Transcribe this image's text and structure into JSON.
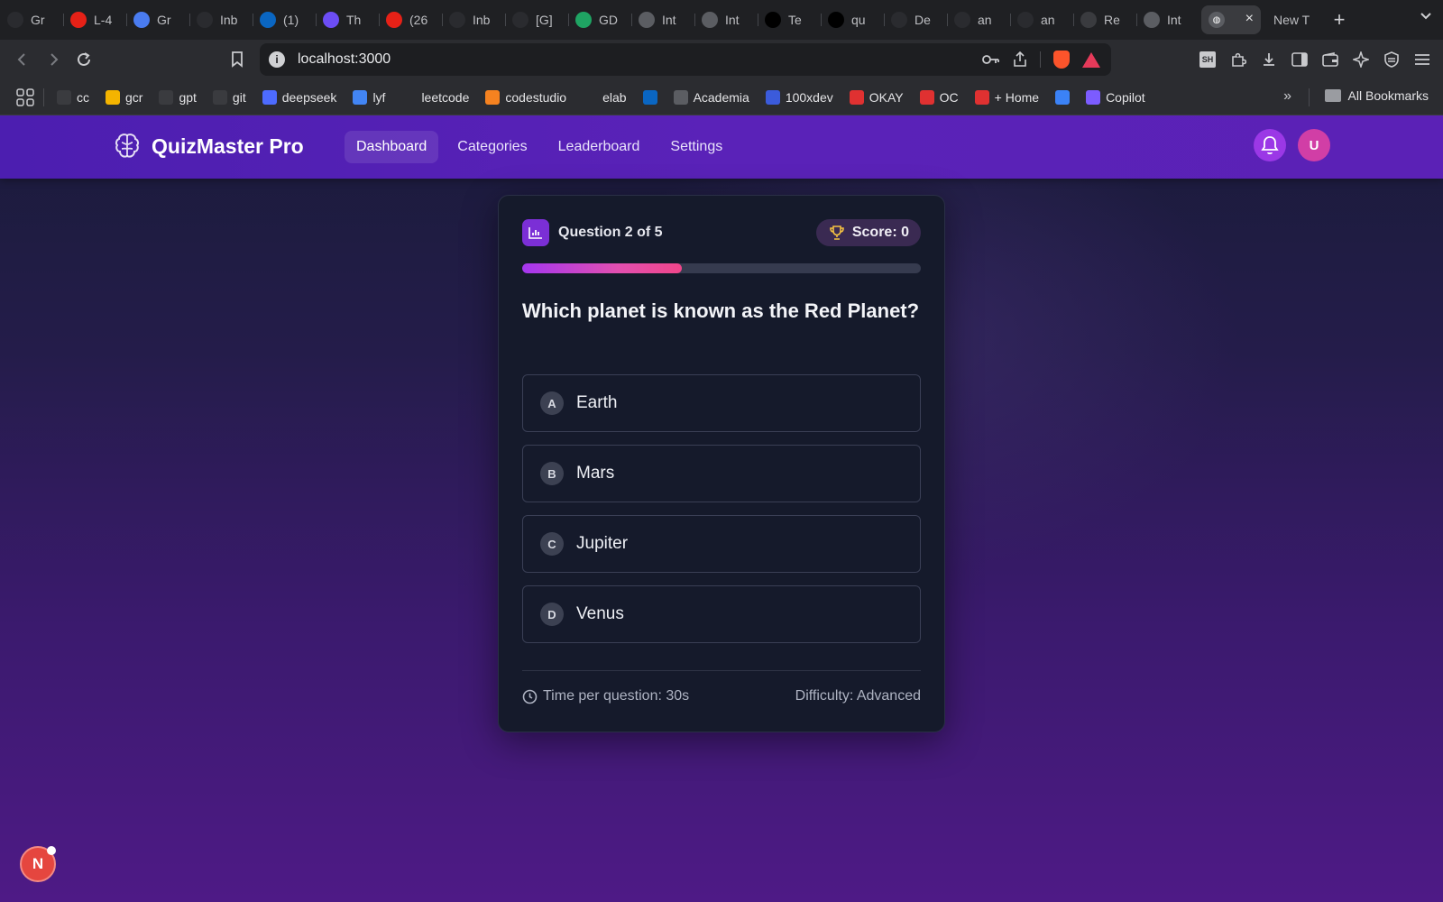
{
  "browser": {
    "tabs": [
      {
        "title": "Gr",
        "icon": "openai-icon",
        "color": "#2a2b2f"
      },
      {
        "title": "L-4",
        "icon": "youtube-icon",
        "color": "#e62117"
      },
      {
        "title": "Gr",
        "icon": "app-icon",
        "color": "#4a7cf0"
      },
      {
        "title": "Inb",
        "icon": "gmail-icon",
        "color": "#2a2b2f"
      },
      {
        "title": "(1)",
        "icon": "linkedin-icon",
        "color": "#0a66c2"
      },
      {
        "title": "Th",
        "icon": "app-icon",
        "color": "#6c4df5"
      },
      {
        "title": "(26",
        "icon": "youtube-icon",
        "color": "#e62117"
      },
      {
        "title": "Inb",
        "icon": "gmail-icon",
        "color": "#2a2b2f"
      },
      {
        "title": "[G]",
        "icon": "gmail-icon",
        "color": "#2a2b2f"
      },
      {
        "title": "GD",
        "icon": "drive-icon",
        "color": "#1fa463"
      },
      {
        "title": "Int",
        "icon": "globe-icon",
        "color": "#5b5d62"
      },
      {
        "title": "Int",
        "icon": "globe-icon",
        "color": "#5b5d62"
      },
      {
        "title": "Te",
        "icon": "vercel-icon",
        "color": "#000000"
      },
      {
        "title": "qu",
        "icon": "vercel-icon",
        "color": "#000000"
      },
      {
        "title": "De",
        "icon": "openai-icon",
        "color": "#2a2b2f"
      },
      {
        "title": "an",
        "icon": "github-icon",
        "color": "#2a2b2f"
      },
      {
        "title": "an",
        "icon": "github-icon",
        "color": "#2a2b2f"
      },
      {
        "title": "Re",
        "icon": "app-icon",
        "color": "#3a3b3f"
      },
      {
        "title": "Int",
        "icon": "globe-icon",
        "color": "#5b5d62"
      }
    ],
    "active_tab": {
      "close": "×"
    },
    "new_tab": {
      "title": "New T"
    },
    "plus": "+",
    "url": "localhost:3000",
    "bookmarks": [
      {
        "label": "cc",
        "icon": "cc-icon",
        "color": "#3a3b3f"
      },
      {
        "label": "gcr",
        "icon": "classroom-icon",
        "color": "#f4b400"
      },
      {
        "label": "gpt",
        "icon": "openai-icon",
        "color": "#3a3b3f"
      },
      {
        "label": "git",
        "icon": "github-icon",
        "color": "#3a3b3f"
      },
      {
        "label": "deepseek",
        "icon": "deepseek-icon",
        "color": "#4d6bfe"
      },
      {
        "label": "lyf",
        "icon": "docs-icon",
        "color": "#4285f4"
      },
      {
        "label": "leetcode",
        "icon": "leetcode-icon",
        "color": "#2b2c30"
      },
      {
        "label": "codestudio",
        "icon": "codestudio-icon",
        "color": "#f58220"
      },
      {
        "label": "elab",
        "icon": "react-icon",
        "color": "#2b2c30"
      },
      {
        "label": "",
        "icon": "linkedin-icon",
        "color": "#0a66c2"
      },
      {
        "label": "Academia",
        "icon": "globe-icon",
        "color": "#5b5d62"
      },
      {
        "label": "100xdev",
        "icon": "avatar-icon",
        "color": "#3b5bdb"
      },
      {
        "label": "OKAY",
        "icon": "tuf-icon",
        "color": "#e03131"
      },
      {
        "label": "OC",
        "icon": "tuf-icon",
        "color": "#e03131"
      },
      {
        "label": "+ Home",
        "icon": "tuf-icon",
        "color": "#e03131"
      },
      {
        "label": "",
        "icon": "bookmark-app-icon",
        "color": "#3b82f6"
      },
      {
        "label": "Copilot",
        "icon": "copilot-icon",
        "color": "#7c5cff"
      }
    ],
    "bookmarks_more": "»",
    "all_bookmarks": "All Bookmarks"
  },
  "app": {
    "brand": "QuizMaster Pro",
    "nav": [
      {
        "label": "Dashboard",
        "active": true
      },
      {
        "label": "Categories",
        "active": false
      },
      {
        "label": "Leaderboard",
        "active": false
      },
      {
        "label": "Settings",
        "active": false
      }
    ],
    "avatar_initial": "U",
    "quiz": {
      "question_counter": "Question 2 of 5",
      "score": "Score: 0",
      "progress": 0.4,
      "question": "Which planet is known as the Red Planet?",
      "options": [
        {
          "letter": "A",
          "text": "Earth"
        },
        {
          "letter": "B",
          "text": "Mars"
        },
        {
          "letter": "C",
          "text": "Jupiter"
        },
        {
          "letter": "D",
          "text": "Venus"
        }
      ],
      "time_per_question": "Time per question: 30s",
      "difficulty": "Difficulty: Advanced"
    },
    "dev_badge": "N"
  },
  "colors": {
    "accent": "#7b2fd6",
    "nav_bg": "#5a22b8",
    "progress_start": "#a436f0",
    "progress_end": "#f0468a",
    "card_bg": "#151a2b"
  }
}
